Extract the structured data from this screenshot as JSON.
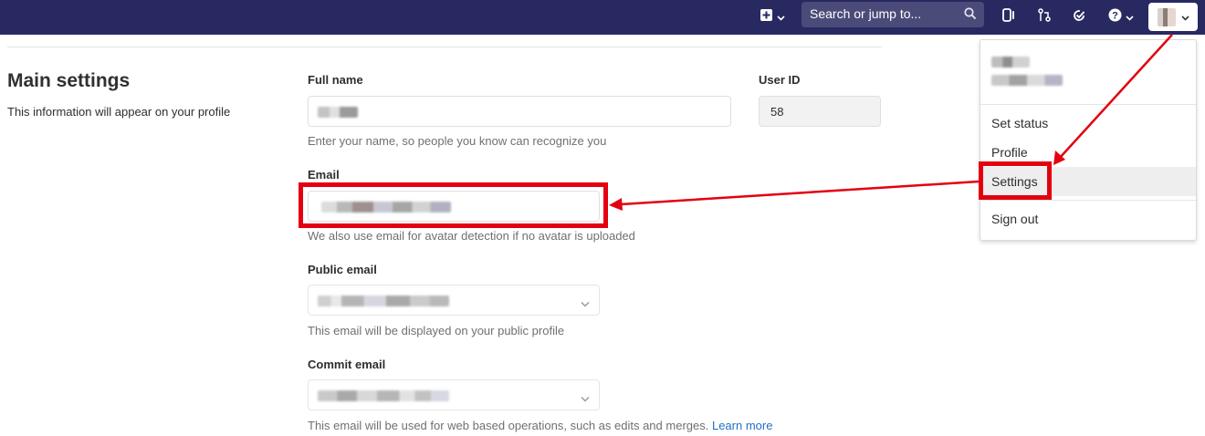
{
  "navbar": {
    "search_placeholder": "Search or jump to...",
    "icons": [
      "plus-square-icon",
      "chevron-down-icon",
      "search-icon",
      "issues-icon",
      "merge-request-icon",
      "todo-icon",
      "help-icon",
      "avatar"
    ]
  },
  "main_settings": {
    "title": "Main settings",
    "description": "This information will appear on your profile"
  },
  "form": {
    "full_name": {
      "label": "Full name",
      "help": "Enter your name, so people you know can recognize you"
    },
    "user_id": {
      "label": "User ID",
      "value": "58"
    },
    "email": {
      "label": "Email",
      "help": "We also use email for avatar detection if no avatar is uploaded"
    },
    "public_email": {
      "label": "Public email",
      "help": "This email will be displayed on your public profile"
    },
    "commit_email": {
      "label": "Commit email",
      "help": "This email will be used for web based operations, such as edits and merges.",
      "link": "Learn more"
    }
  },
  "user_menu": {
    "items": [
      "Set status",
      "Profile",
      "Settings",
      "Sign out"
    ],
    "active": "Settings"
  },
  "colors": {
    "navbar": "#292961",
    "highlight": "#e4000f",
    "link": "#1f6fc5"
  }
}
